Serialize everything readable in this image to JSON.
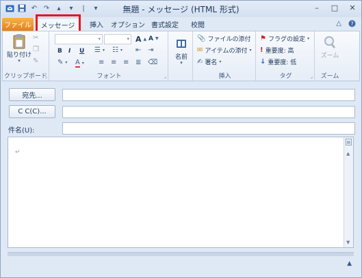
{
  "window": {
    "title": "無題 - メッセージ (HTML 形式)"
  },
  "quick_access": {
    "separator": "|",
    "customize": "▾"
  },
  "tabs": [
    {
      "label": "ファイル"
    },
    {
      "label": "メッセージ"
    },
    {
      "label": "挿入"
    },
    {
      "label": "オプション"
    },
    {
      "label": "書式設定"
    },
    {
      "label": "校閲"
    }
  ],
  "ribbon": {
    "clipboard": {
      "label": "クリップボード",
      "paste": "貼り付け"
    },
    "font": {
      "label": "フォント",
      "bold": "B",
      "italic": "I",
      "underline": "U",
      "grow": "A",
      "shrink": "A"
    },
    "names": {
      "label": "名前"
    },
    "include": {
      "label": "挿入",
      "attach_file": "ファイルの添付",
      "attach_item": "アイテムの添付",
      "signature": "署名"
    },
    "tags": {
      "label": "タグ",
      "follow_up": "フラグの設定",
      "high_importance": "重要度: 高",
      "low_importance": "重要度: 低"
    },
    "zoom": {
      "button": "ズーム",
      "label": "ズーム"
    }
  },
  "fields": {
    "to_button": "宛先...",
    "cc_button": "C C(C)...",
    "subject_label": "件名(U):",
    "to_value": "",
    "cc_value": "",
    "subject_value": ""
  },
  "body": {
    "paragraph_mark": "↵"
  },
  "colors": {
    "file_tab": "#e2801c",
    "highlight": "#e8141f",
    "accent": "#1e395b"
  }
}
